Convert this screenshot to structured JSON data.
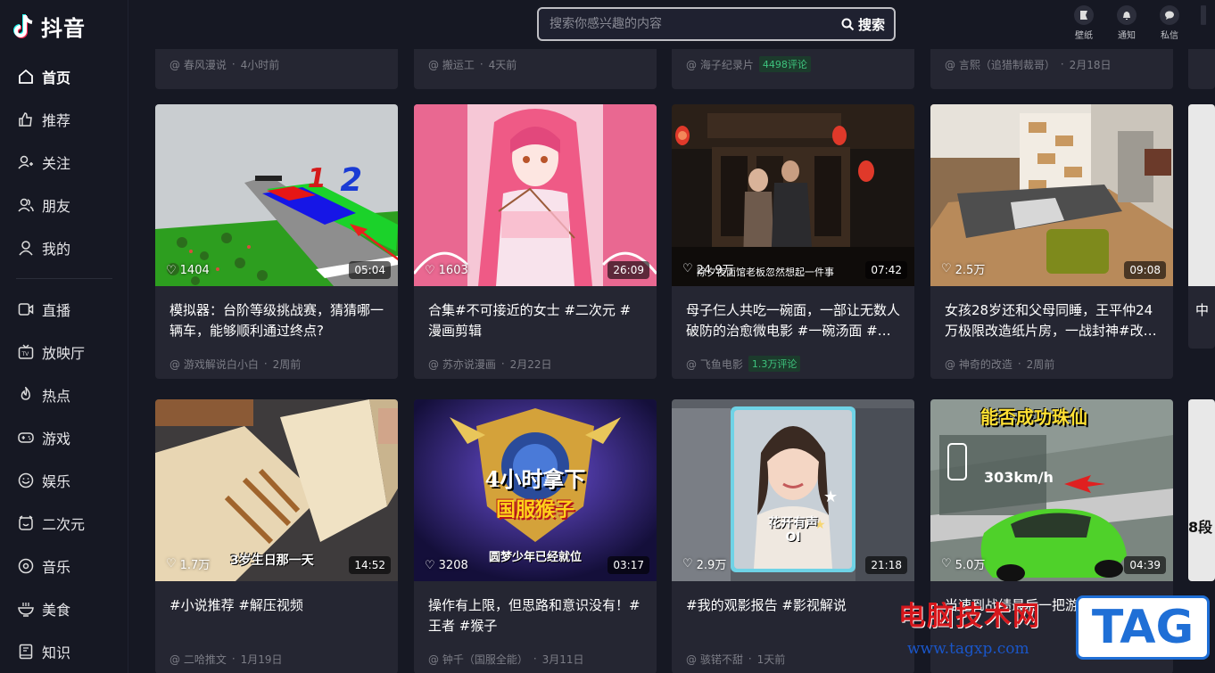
{
  "app": {
    "name": "抖音"
  },
  "search": {
    "placeholder": "搜索你感兴趣的内容",
    "button_label": "搜索"
  },
  "header_icons": [
    {
      "icon": "wallpaper-icon",
      "label": "壁纸"
    },
    {
      "icon": "bell-icon",
      "label": "通知"
    },
    {
      "icon": "message-icon",
      "label": "私信"
    }
  ],
  "sidebar": {
    "items": [
      {
        "label": "首页",
        "icon": "home-icon"
      },
      {
        "label": "推荐",
        "icon": "thumb-up-icon"
      },
      {
        "label": "关注",
        "icon": "add-user-icon"
      },
      {
        "label": "朋友",
        "icon": "friends-icon"
      },
      {
        "label": "我的",
        "icon": "user-icon"
      },
      {
        "label": "直播",
        "icon": "live-icon"
      },
      {
        "label": "放映厅",
        "icon": "tv-icon"
      },
      {
        "label": "热点",
        "icon": "flame-icon"
      },
      {
        "label": "游戏",
        "icon": "gamepad-icon"
      },
      {
        "label": "娱乐",
        "icon": "smile-icon"
      },
      {
        "label": "二次元",
        "icon": "clock-icon"
      },
      {
        "label": "音乐",
        "icon": "music-icon"
      },
      {
        "label": "美食",
        "icon": "bowl-icon"
      },
      {
        "label": "知识",
        "icon": "book-icon"
      }
    ]
  },
  "top_row": [
    {
      "author": "@ 春风漫说",
      "time": "4小时前"
    },
    {
      "author": "@ 搬运工",
      "time": "4天前"
    },
    {
      "author": "@ 海子纪录片",
      "badge": "4498评论"
    },
    {
      "author": "@ 言熙（追猎制裁哥）",
      "time": "2月18日"
    }
  ],
  "videos": [
    {
      "likes": "1404",
      "duration": "05:04",
      "title": "模拟器：台阶等级挑战赛，猜猜哪一辆车，能够顺利通过终点?",
      "author": "@ 游戏解说白小白",
      "time": "2周前",
      "thumb_text": ""
    },
    {
      "likes": "1603",
      "duration": "26:09",
      "title": "合集#不可接近的女士 #二次元 #漫画剪辑",
      "author": "@ 苏亦说漫画",
      "time": "2月22日",
      "thumb_text": ""
    },
    {
      "likes": "24.9万",
      "duration": "07:42",
      "title": "母子仨人共吃一碗面，一部让无数人破防的治愈微电影 #一碗汤面 #…",
      "author": "@ 飞鱼电影",
      "badge": "1.3万评论",
      "thumb_text": "除夕夜面馆老板忽然想起一件事"
    },
    {
      "likes": "2.5万",
      "duration": "09:08",
      "title": "女孩28岁还和父母同睡，王平仲24万极限改造纸片房，一战封神#改…",
      "author": "@ 神奇的改造",
      "time": "2周前",
      "thumb_text": ""
    },
    {
      "likes": "1.7万",
      "duration": "14:52",
      "title": "#小说推荐 #解压视频",
      "author": "@ 二哈推文",
      "time": "1月19日",
      "thumb_text": "3岁生日那一天"
    },
    {
      "likes": "3208",
      "duration": "03:17",
      "title": "操作有上限，但思路和意识没有！#王者 #猴子",
      "author": "@ 钟千（国服全能）",
      "time": "3月11日",
      "thumb_text": "4小时拿下",
      "thumb_text2": "国服猴子",
      "thumb_text3": "圆梦少年已经就位"
    },
    {
      "likes": "2.9万",
      "duration": "21:18",
      "title": "#我的观影报告 #影视解说",
      "author": "@ 骇锘不甜",
      "time": "1天前",
      "thumb_text": "花开有声",
      "thumb_text2": "OI"
    },
    {
      "likes": "5.0万",
      "duration": "04:39",
      "title": "当速到战绩最后一把游劫…确撞车…",
      "author": "",
      "time": "",
      "thumb_text": "能否成功珠仙",
      "thumb_text2": "303km/h"
    }
  ],
  "partial_right": {
    "row1_title_char": "中",
    "row2_text": "8段"
  },
  "watermark": {
    "line1": "电脑技术网",
    "line2": "www.tagxp.com",
    "tag": "TAG"
  }
}
